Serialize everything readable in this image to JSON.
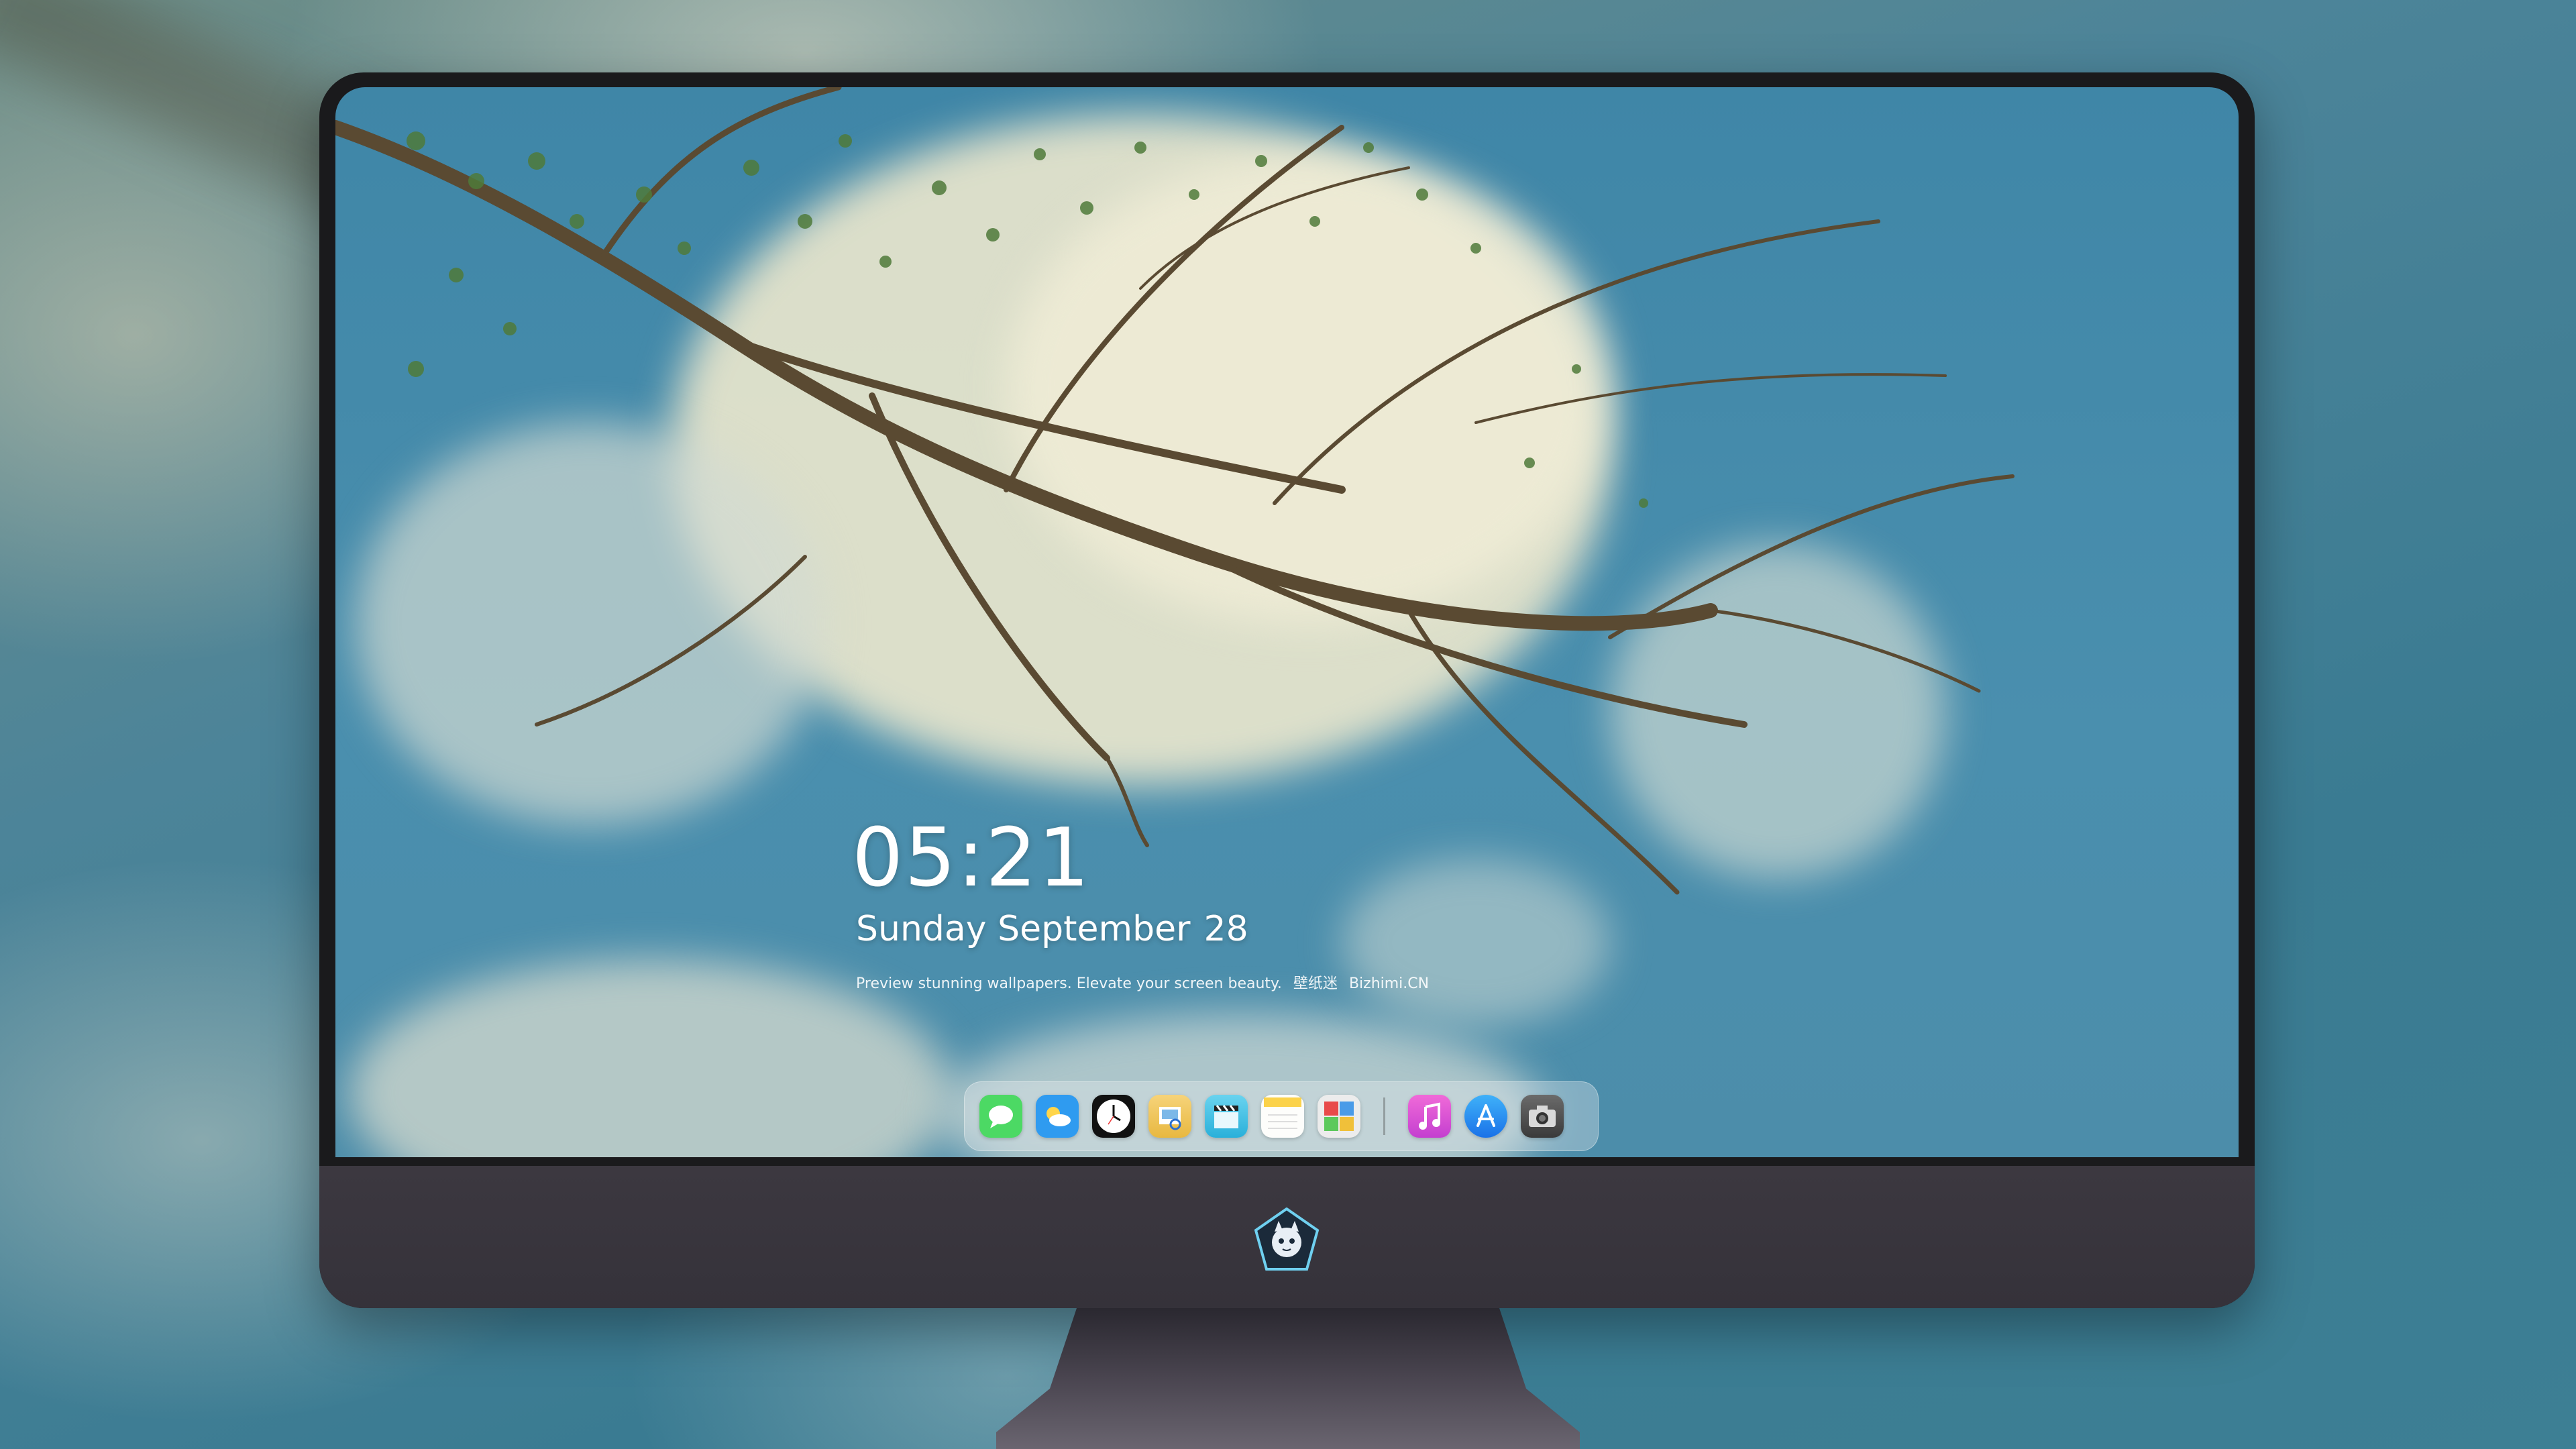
{
  "lockscreen": {
    "time": "05:21",
    "weekday_month": "Sunday September",
    "day": "28",
    "tagline_left": "Preview stunning wallpapers. Elevate your screen beauty.",
    "tagline_brand_cn": "壁纸迷",
    "tagline_brand": "Bizhimi.CN"
  },
  "dock": {
    "apps": [
      {
        "name": "Messages",
        "icon": "messages-icon",
        "color": "#4cd964"
      },
      {
        "name": "Weather",
        "icon": "weather-icon",
        "color": "#2f9bf0"
      },
      {
        "name": "Clock",
        "icon": "clock-icon",
        "color": "#111111"
      },
      {
        "name": "Preview",
        "icon": "preview-icon",
        "color": "#f0c24a"
      },
      {
        "name": "Clips",
        "icon": "clapperboard-icon",
        "color": "#3bbfe0"
      },
      {
        "name": "Notes",
        "icon": "notes-icon",
        "color": "#fbd24a"
      },
      {
        "name": "Photo Booth",
        "icon": "photo-booth-icon",
        "color": "#e8e8e8"
      },
      {
        "name": "iTunes",
        "icon": "music-icon",
        "color": "#e04fd2"
      },
      {
        "name": "App Store",
        "icon": "app-store-icon",
        "color": "#1e8cf5"
      },
      {
        "name": "Camera",
        "icon": "camera-icon",
        "color": "#4a4a4a"
      }
    ]
  }
}
